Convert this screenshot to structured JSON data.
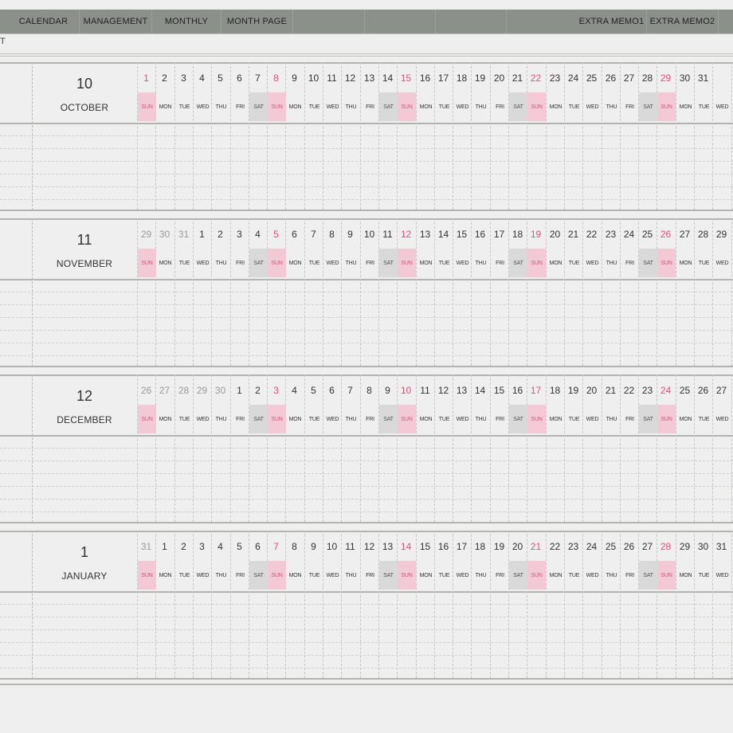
{
  "nav": {
    "tabs": [
      "CALENDAR",
      "MANAGEMENT",
      "MONTHLY",
      "MONTH PAGE"
    ],
    "extra_tabs": [
      "EXTRA MEMO1",
      "EXTRA MEMO2"
    ]
  },
  "corner_text": "T",
  "colors": {
    "bar": "#8c908b",
    "sunday_fill": "#f2c9d4",
    "sunday_text": "#e0507a",
    "saturday_fill": "#d9d9d9"
  },
  "months": [
    {
      "number": "10",
      "name": "OCTOBER",
      "days": [
        "1",
        "2",
        "3",
        "4",
        "5",
        "6",
        "7",
        "8",
        "9",
        "10",
        "11",
        "12",
        "13",
        "14",
        "15",
        "16",
        "17",
        "18",
        "19",
        "20",
        "21",
        "22",
        "23",
        "24",
        "25",
        "26",
        "27",
        "28",
        "29",
        "30",
        "31"
      ],
      "prev_count": 0,
      "weekdays": [
        "SUN",
        "MON",
        "TUE",
        "WED",
        "THU",
        "FRI",
        "SAT",
        "SUN",
        "MON",
        "TUE",
        "WED",
        "THU",
        "FRI",
        "SAT",
        "SUN",
        "MON",
        "TUE",
        "WED",
        "THU",
        "FRI",
        "SAT",
        "SUN",
        "MON",
        "TUE",
        "WED",
        "THU",
        "FRI",
        "SAT",
        "SUN",
        "MON",
        "TUE",
        "WED"
      ]
    },
    {
      "number": "11",
      "name": "NOVEMBER",
      "days": [
        "29",
        "30",
        "31",
        "1",
        "2",
        "3",
        "4",
        "5",
        "6",
        "7",
        "8",
        "9",
        "10",
        "11",
        "12",
        "13",
        "14",
        "15",
        "16",
        "17",
        "18",
        "19",
        "20",
        "21",
        "22",
        "23",
        "24",
        "25",
        "26",
        "27",
        "28",
        "29"
      ],
      "prev_count": 3,
      "weekdays": [
        "SUN",
        "MON",
        "TUE",
        "WED",
        "THU",
        "FRI",
        "SAT",
        "SUN",
        "MON",
        "TUE",
        "WED",
        "THU",
        "FRI",
        "SAT",
        "SUN",
        "MON",
        "TUE",
        "WED",
        "THU",
        "FRI",
        "SAT",
        "SUN",
        "MON",
        "TUE",
        "WED",
        "THU",
        "FRI",
        "SAT",
        "SUN",
        "MON",
        "TUE",
        "WED"
      ]
    },
    {
      "number": "12",
      "name": "DECEMBER",
      "days": [
        "26",
        "27",
        "28",
        "29",
        "30",
        "1",
        "2",
        "3",
        "4",
        "5",
        "6",
        "7",
        "8",
        "9",
        "10",
        "11",
        "12",
        "13",
        "14",
        "15",
        "16",
        "17",
        "18",
        "19",
        "20",
        "21",
        "22",
        "23",
        "24",
        "25",
        "26",
        "27"
      ],
      "prev_count": 5,
      "weekdays": [
        "SUN",
        "MON",
        "TUE",
        "WED",
        "THU",
        "FRI",
        "SAT",
        "SUN",
        "MON",
        "TUE",
        "WED",
        "THU",
        "FRI",
        "SAT",
        "SUN",
        "MON",
        "TUE",
        "WED",
        "THU",
        "FRI",
        "SAT",
        "SUN",
        "MON",
        "TUE",
        "WED",
        "THU",
        "FRI",
        "SAT",
        "SUN",
        "MON",
        "TUE",
        "WED"
      ]
    },
    {
      "number": "1",
      "name": "JANUARY",
      "days": [
        "31",
        "1",
        "2",
        "3",
        "4",
        "5",
        "6",
        "7",
        "8",
        "9",
        "10",
        "11",
        "12",
        "13",
        "14",
        "15",
        "16",
        "17",
        "18",
        "19",
        "20",
        "21",
        "22",
        "23",
        "24",
        "25",
        "26",
        "27",
        "28",
        "29",
        "30",
        "31"
      ],
      "prev_count": 1,
      "weekdays": [
        "SUN",
        "MON",
        "TUE",
        "WED",
        "THU",
        "FRI",
        "SAT",
        "SUN",
        "MON",
        "TUE",
        "WED",
        "THU",
        "FRI",
        "SAT",
        "SUN",
        "MON",
        "TUE",
        "WED",
        "THU",
        "FRI",
        "SAT",
        "SUN",
        "MON",
        "TUE",
        "WED",
        "THU",
        "FRI",
        "SAT",
        "SUN",
        "MON",
        "TUE",
        "WED"
      ]
    }
  ]
}
